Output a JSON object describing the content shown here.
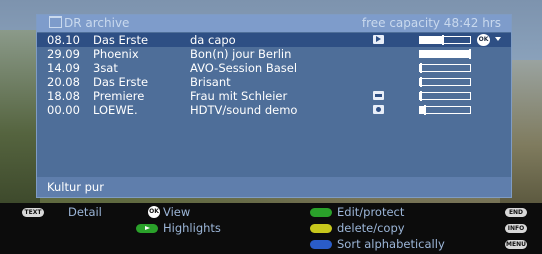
{
  "header": {
    "title": "DR archive",
    "capacity": "free capacity 48:42 hrs"
  },
  "recordings": [
    {
      "date": "08.10",
      "channel": "Das Erste",
      "title": "da capo",
      "icon": "play-icon",
      "progress": 0.46,
      "selected": true
    },
    {
      "date": "29.09",
      "channel": "Phoenix",
      "title": "Bon(n) jour Berlin",
      "icon": "",
      "progress": 1.0,
      "selected": false
    },
    {
      "date": "14.09",
      "channel": "3sat",
      "title": "AVO-Session Basel",
      "icon": "",
      "progress": 0.0,
      "selected": false
    },
    {
      "date": "20.08",
      "channel": "Das Erste",
      "title": "Brisant",
      "icon": "",
      "progress": 0.0,
      "selected": false
    },
    {
      "date": "18.08",
      "channel": "Premiere",
      "title": "Frau mit Schleier",
      "icon": "lock-icon",
      "progress": 0.0,
      "selected": false
    },
    {
      "date": "00.00",
      "channel": "LOEWE.",
      "title": "HDTV/sound demo",
      "icon": "disc-icon",
      "progress": 0.1,
      "selected": false
    }
  ],
  "selected_ok_key": "OK",
  "status_text": "Kultur pur",
  "footer": {
    "text_key": "TEXT",
    "detail": "Detail",
    "ok_key": "OK",
    "view": "View",
    "highlights": "Highlights",
    "edit_protect": "Edit/protect",
    "delete_copy": "delete/copy",
    "sort": "Sort alphabetically",
    "end_key": "END",
    "info_key": "INFO",
    "menu_key": "MENU"
  },
  "colors": {
    "green": "#2aa12a",
    "yellow": "#c7c71c",
    "blue": "#2a5cc7",
    "highlight": "#2e4f84"
  }
}
